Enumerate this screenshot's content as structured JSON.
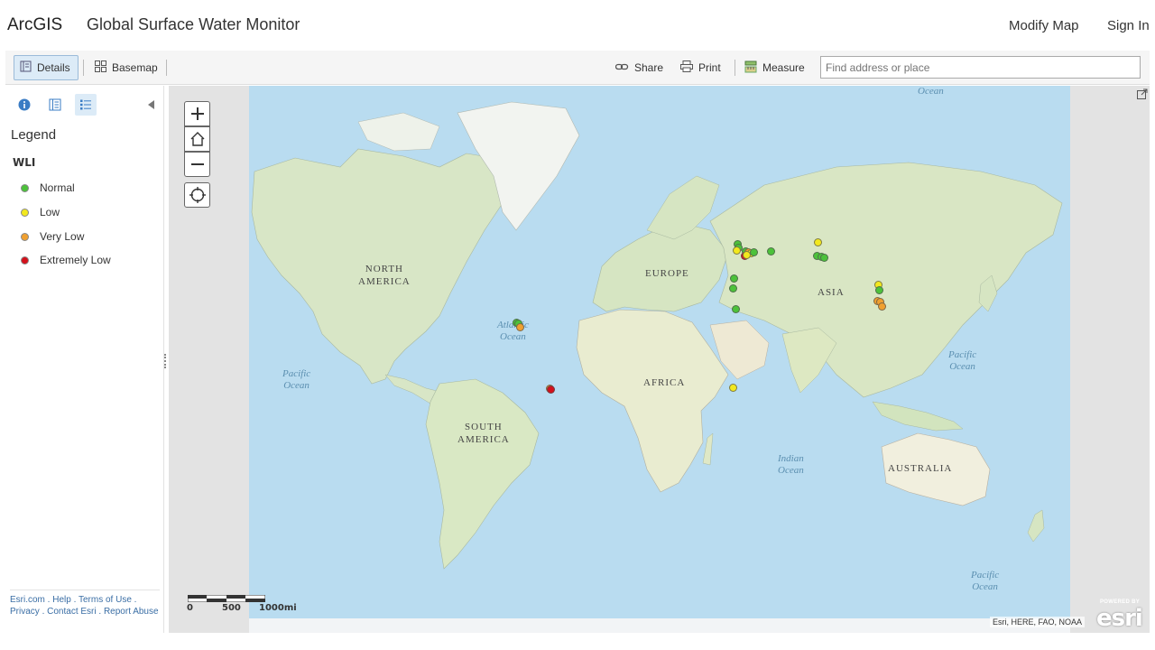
{
  "header": {
    "brand": "ArcGIS",
    "title": "Global Surface Water Monitor",
    "modify_map": "Modify Map",
    "sign_in": "Sign In"
  },
  "toolbar": {
    "details": "Details",
    "basemap": "Basemap",
    "share": "Share",
    "print": "Print",
    "measure": "Measure",
    "search_placeholder": "Find address or place"
  },
  "panel": {
    "legend_title": "Legend",
    "layer_name": "WLI",
    "items": [
      {
        "label": "Normal",
        "color": "#4cc23a"
      },
      {
        "label": "Low",
        "color": "#f2e81e"
      },
      {
        "label": "Very Low",
        "color": "#f0a030"
      },
      {
        "label": "Extremely Low",
        "color": "#d4101b"
      }
    ],
    "footer": {
      "esri": "Esri.com",
      "help": "Help",
      "terms": "Terms of Use",
      "privacy": "Privacy",
      "contact": "Contact Esri",
      "report": "Report Abuse"
    }
  },
  "map": {
    "scale": {
      "l0": "0",
      "l1": "500",
      "l2": "1000mi"
    },
    "attribution": "Esri, HERE, FAO, NOAA",
    "logo_powered": "POWERED BY",
    "logo_word": "esri",
    "continents": {
      "north_america": "NORTH\nAMERICA",
      "south_america": "SOUTH\nAMERICA",
      "europe": "EUROPE",
      "africa": "AFRICA",
      "asia": "ASIA",
      "australia": "AUSTRALIA"
    },
    "oceans": {
      "atlantic": "Atlantic\nOcean",
      "pacific_w": "Pacific\nOcean",
      "pacific_e": "Pacific\nOcean",
      "pacific_se": "Pacific\nOcean",
      "indian": "Indian\nOcean",
      "arctic": "Ocean"
    },
    "points": [
      {
        "status": "Normal",
        "lon": -62.5,
        "lat": 7.2
      },
      {
        "status": "Normal",
        "lon": -61.5,
        "lat": 7.0
      },
      {
        "status": "Very Low",
        "lon": -61.0,
        "lat": 5.5
      },
      {
        "status": "Very Low",
        "lon": -48.0,
        "lat": -21.0
      },
      {
        "status": "Extremely Low",
        "lon": -47.5,
        "lat": -21.2
      },
      {
        "status": "Normal",
        "lon": 33.0,
        "lat": 26.5
      },
      {
        "status": "Normal",
        "lon": 32.5,
        "lat": 22.0
      },
      {
        "status": "Normal",
        "lon": 33.5,
        "lat": 13.0
      },
      {
        "status": "Low",
        "lon": 32.5,
        "lat": -20.5
      },
      {
        "status": "Normal",
        "lon": 34.5,
        "lat": 41.0
      },
      {
        "status": "Normal",
        "lon": 34.8,
        "lat": 39.5
      },
      {
        "status": "Low",
        "lon": 34.0,
        "lat": 38.5
      },
      {
        "status": "Normal",
        "lon": 38.0,
        "lat": 38.0
      },
      {
        "status": "Very Low",
        "lon": 39.0,
        "lat": 37.5
      },
      {
        "status": "Low",
        "lon": 40.5,
        "lat": 37.2
      },
      {
        "status": "Extremely Low",
        "lon": 37.5,
        "lat": 36.0
      },
      {
        "status": "Low",
        "lon": 38.5,
        "lat": 36.5
      },
      {
        "status": "Normal",
        "lon": 41.5,
        "lat": 37.5
      },
      {
        "status": "Normal",
        "lon": 49.0,
        "lat": 38.0
      },
      {
        "status": "Low",
        "lon": 69.5,
        "lat": 42.0
      },
      {
        "status": "Normal",
        "lon": 69.0,
        "lat": 36.0
      },
      {
        "status": "Normal",
        "lon": 71.0,
        "lat": 35.5
      },
      {
        "status": "Normal",
        "lon": 72.5,
        "lat": 35.2
      },
      {
        "status": "Low",
        "lon": 96.0,
        "lat": 23.5
      },
      {
        "status": "Normal",
        "lon": 96.5,
        "lat": 21.5
      },
      {
        "status": "Very Low",
        "lon": 95.5,
        "lat": 16.5
      },
      {
        "status": "Very Low",
        "lon": 97.0,
        "lat": 16.2
      },
      {
        "status": "Very Low",
        "lon": 97.5,
        "lat": 14.5
      }
    ]
  }
}
